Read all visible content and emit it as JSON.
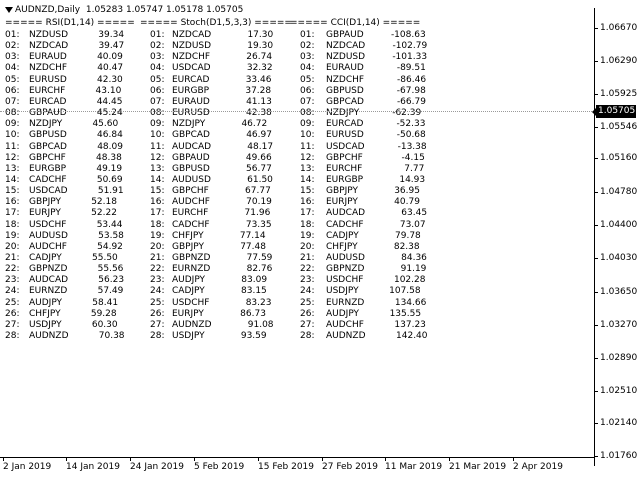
{
  "header": {
    "symbol": "AUDNZD,Daily",
    "ohlc": "1.05283 1.05747 1.05178 1.05705"
  },
  "current_price": "1.05705",
  "price_axis": [
    "1.06670",
    "1.06290",
    "1.05925",
    "1.05546",
    "1.05160",
    "1.04780",
    "1.04400",
    "1.04030",
    "1.03650",
    "1.03270",
    "1.02890",
    "1.02510",
    "1.02140",
    "1.01760"
  ],
  "time_axis": [
    "2 Jan 2019",
    "14 Jan 2019",
    "24 Jan 2019",
    "5 Feb 2019",
    "15 Feb 2019",
    "27 Feb 2019",
    "11 Mar 2019",
    "21 Mar 2019",
    "2 Apr 2019"
  ],
  "indicators": [
    {
      "title": "===== RSI(D1,14) =====",
      "rows": [
        [
          "01:",
          "NZDUSD",
          "39.34"
        ],
        [
          "02:",
          "NZDCAD",
          "39.47"
        ],
        [
          "03:",
          "EURAUD",
          "40.09"
        ],
        [
          "04:",
          "NZDCHF",
          "40.47"
        ],
        [
          "05:",
          "EURUSD",
          "42.30"
        ],
        [
          "06:",
          "EURCHF",
          "43.10"
        ],
        [
          "07:",
          "EURCAD",
          "44.45"
        ],
        [
          "08:",
          "GBPAUD",
          "45.24"
        ],
        [
          "09:",
          "NZDJPY",
          "45.60"
        ],
        [
          "10:",
          "GBPUSD",
          "46.84"
        ],
        [
          "11:",
          "GBPCAD",
          "48.09"
        ],
        [
          "12:",
          "GBPCHF",
          "48.38"
        ],
        [
          "13:",
          "EURGBP",
          "49.19"
        ],
        [
          "14:",
          "CADCHF",
          "50.69"
        ],
        [
          "15:",
          "USDCAD",
          "51.91"
        ],
        [
          "16:",
          "GBPJPY",
          "52.18"
        ],
        [
          "17:",
          "EURJPY",
          "52.22"
        ],
        [
          "18:",
          "USDCHF",
          "53.44"
        ],
        [
          "19:",
          "AUDUSD",
          "53.58"
        ],
        [
          "20:",
          "AUDCHF",
          "54.92"
        ],
        [
          "21:",
          "CADJPY",
          "55.50"
        ],
        [
          "22:",
          "GBPNZD",
          "55.56"
        ],
        [
          "23:",
          "AUDCAD",
          "56.23"
        ],
        [
          "24:",
          "EURNZD",
          "57.49"
        ],
        [
          "25:",
          "AUDJPY",
          "58.41"
        ],
        [
          "26:",
          "CHFJPY",
          "59.28"
        ],
        [
          "27:",
          "USDJPY",
          "60.30"
        ],
        [
          "28:",
          "AUDNZD",
          "70.38"
        ]
      ]
    },
    {
      "title": "===== Stoch(D1,5,3,3) =====",
      "rows": [
        [
          "01:",
          "NZDCAD",
          "17.30"
        ],
        [
          "02:",
          "NZDUSD",
          "19.30"
        ],
        [
          "03:",
          "NZDCHF",
          "26.74"
        ],
        [
          "04:",
          "USDCAD",
          "32.32"
        ],
        [
          "05:",
          "EURCAD",
          "33.46"
        ],
        [
          "06:",
          "EURGBP",
          "37.28"
        ],
        [
          "07:",
          "EURAUD",
          "41.13"
        ],
        [
          "08:",
          "EURUSD",
          "42.38"
        ],
        [
          "09:",
          "NZDJPY",
          "46.72"
        ],
        [
          "10:",
          "GBPCAD",
          "46.97"
        ],
        [
          "11:",
          "AUDCAD",
          "48.17"
        ],
        [
          "12:",
          "GBPAUD",
          "49.66"
        ],
        [
          "13:",
          "GBPUSD",
          "56.77"
        ],
        [
          "14:",
          "AUDUSD",
          "61.50"
        ],
        [
          "15:",
          "GBPCHF",
          "67.77"
        ],
        [
          "16:",
          "AUDCHF",
          "70.19"
        ],
        [
          "17:",
          "EURCHF",
          "71.96"
        ],
        [
          "18:",
          "CADCHF",
          "73.35"
        ],
        [
          "19:",
          "CHFJPY",
          "77.14"
        ],
        [
          "20:",
          "GBPJPY",
          "77.48"
        ],
        [
          "21:",
          "GBPNZD",
          "77.59"
        ],
        [
          "22:",
          "EURNZD",
          "82.76"
        ],
        [
          "23:",
          "AUDJPY",
          "83.09"
        ],
        [
          "24:",
          "CADJPY",
          "83.15"
        ],
        [
          "25:",
          "USDCHF",
          "83.23"
        ],
        [
          "26:",
          "EURJPY",
          "86.73"
        ],
        [
          "27:",
          "AUDNZD",
          "91.08"
        ],
        [
          "28:",
          "USDJPY",
          "93.59"
        ]
      ]
    },
    {
      "title": "===== CCI(D1,14) =====",
      "rows": [
        [
          "01:",
          "GBPAUD",
          "-108.63"
        ],
        [
          "02:",
          "NZDCAD",
          "-102.79"
        ],
        [
          "03:",
          "NZDUSD",
          "-101.33"
        ],
        [
          "04:",
          "EURAUD",
          "-89.51"
        ],
        [
          "05:",
          "NZDCHF",
          "-86.46"
        ],
        [
          "06:",
          "GBPUSD",
          "-67.98"
        ],
        [
          "07:",
          "GBPCAD",
          "-66.79"
        ],
        [
          "08:",
          "NZDJPY",
          "-62.39"
        ],
        [
          "09:",
          "EURCAD",
          "-52.33"
        ],
        [
          "10:",
          "EURUSD",
          "-50.68"
        ],
        [
          "11:",
          "USDCAD",
          "-13.38"
        ],
        [
          "12:",
          "GBPCHF",
          "-4.15"
        ],
        [
          "13:",
          "EURCHF",
          "7.77"
        ],
        [
          "14:",
          "EURGBP",
          "14.93"
        ],
        [
          "15:",
          "GBPJPY",
          "36.95"
        ],
        [
          "16:",
          "EURJPY",
          "40.79"
        ],
        [
          "17:",
          "AUDCAD",
          "63.45"
        ],
        [
          "18:",
          "CADCHF",
          "73.07"
        ],
        [
          "19:",
          "CADJPY",
          "79.78"
        ],
        [
          "20:",
          "CHFJPY",
          "82.38"
        ],
        [
          "21:",
          "AUDUSD",
          "84.36"
        ],
        [
          "22:",
          "GBPNZD",
          "91.19"
        ],
        [
          "23:",
          "USDCHF",
          "102.28"
        ],
        [
          "24:",
          "USDJPY",
          "107.58"
        ],
        [
          "25:",
          "EURNZD",
          "134.66"
        ],
        [
          "26:",
          "AUDJPY",
          "135.55"
        ],
        [
          "27:",
          "AUDCHF",
          "137.23"
        ],
        [
          "28:",
          "AUDNZD",
          "142.40"
        ]
      ]
    }
  ]
}
